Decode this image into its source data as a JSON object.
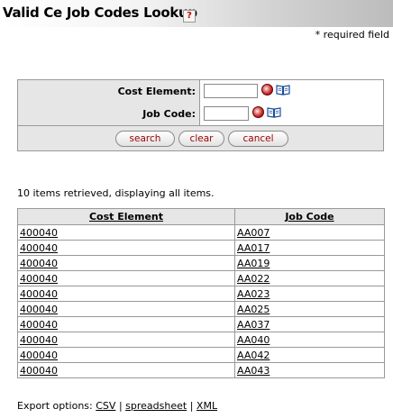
{
  "header": {
    "title": "Valid Ce Job Codes Lookup",
    "help_icon": "help-icon",
    "help_glyph": "?",
    "required_note": "* required field"
  },
  "criteria": {
    "cost_element_label": "Cost Element:",
    "cost_element_value": "",
    "job_code_label": "Job Code:",
    "job_code_value": "",
    "lookup_icon": "magnifier-icon",
    "inquiry_icon": "book-icon"
  },
  "buttons": {
    "search": "search",
    "clear": "clear",
    "cancel": "cancel"
  },
  "results": {
    "status": "10 items retrieved, displaying all items.",
    "columns": [
      "Cost Element",
      "Job Code"
    ],
    "rows": [
      [
        "400040",
        "AA007"
      ],
      [
        "400040",
        "AA017"
      ],
      [
        "400040",
        "AA019"
      ],
      [
        "400040",
        "AA022"
      ],
      [
        "400040",
        "AA023"
      ],
      [
        "400040",
        "AA025"
      ],
      [
        "400040",
        "AA037"
      ],
      [
        "400040",
        "AA040"
      ],
      [
        "400040",
        "AA042"
      ],
      [
        "400040",
        "AA043"
      ]
    ]
  },
  "export": {
    "label": "Export options:",
    "csv": "CSV",
    "spreadsheet": "spreadsheet",
    "xml": "XML",
    "separator": "|"
  },
  "colors": {
    "button_text": "#990000",
    "panel_bg": "#e6e6e6",
    "border": "#999999"
  }
}
